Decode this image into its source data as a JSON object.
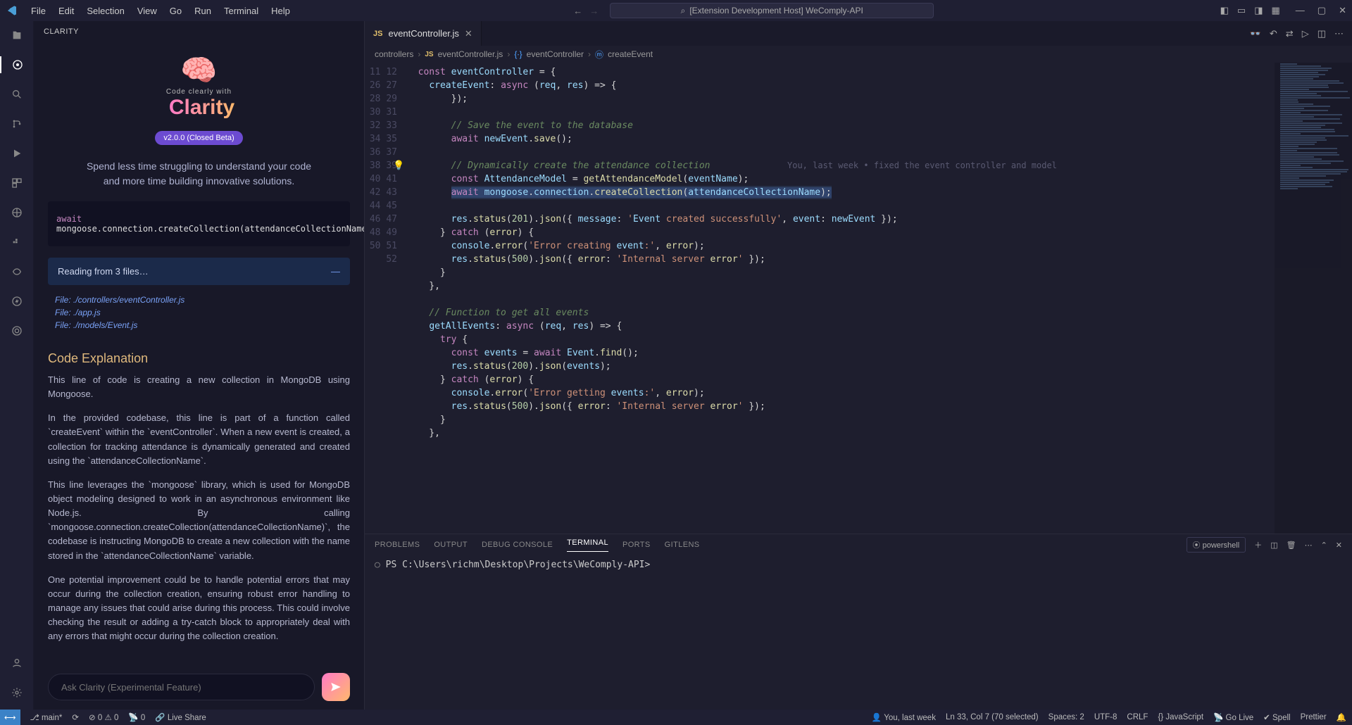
{
  "menu": [
    "File",
    "Edit",
    "Selection",
    "View",
    "Go",
    "Run",
    "Terminal",
    "Help"
  ],
  "search_text": "[Extension Development Host] WeComply-API",
  "sidebar_title": "CLARITY",
  "clarity": {
    "code_clearly": "Code clearly with",
    "name": "Clarity",
    "version": "v2.0.0 (Closed Beta)",
    "tagline1": "Spend less time struggling to understand your code",
    "tagline2": "and more time building innovative solutions.",
    "snippet_kw": "await",
    "snippet_rest": " mongoose.connection.createCollection(attendanceCollectionName);",
    "reading": "Reading from 3 files…",
    "files": [
      "File: ./controllers/eventController.js",
      "File: ./app.js",
      "File: ./models/Event.js"
    ],
    "section": "Code Explanation",
    "p1": "This line of code is creating a new collection in MongoDB using Mongoose.",
    "p2": "In the provided codebase, this line is part of a function called `createEvent` within the `eventController`. When a new event is created, a collection for tracking attendance is dynamically generated and created using the `attendanceCollectionName`.",
    "p3": "This line leverages the `mongoose` library, which is used for MongoDB object modeling designed to work in an asynchronous environment like Node.js. By calling `mongoose.connection.createCollection(attendanceCollectionName)`, the codebase is instructing MongoDB to create a new collection with the name stored in the `attendanceCollectionName` variable.",
    "p4": "One potential improvement could be to handle potential errors that may occur during the collection creation, ensuring robust error handling to manage any issues that could arise during this process. This could involve checking the result or adding a try-catch block to appropriately deal with any errors that might occur during the collection creation.",
    "ask_placeholder": "Ask Clarity (Experimental Feature)"
  },
  "tab": {
    "icon": "JS",
    "name": "eventController.js"
  },
  "breadcrumb": [
    "controllers",
    "eventController.js",
    "eventController",
    "createEvent"
  ],
  "blame": "You, last week • fixed the event controller and model",
  "lines": [
    {
      "n": "11",
      "t": "  const eventController = {",
      "cls": ""
    },
    {
      "n": "12",
      "t": "    createEvent: async (req, res) => {",
      "cls": ""
    },
    {
      "n": "26",
      "t": "        });",
      "cls": ""
    },
    {
      "n": "27",
      "t": "",
      "cls": ""
    },
    {
      "n": "28",
      "t": "        // Save the event to the database",
      "cls": "cm"
    },
    {
      "n": "29",
      "t": "        await newEvent.save();",
      "cls": ""
    },
    {
      "n": "30",
      "t": "",
      "cls": ""
    },
    {
      "n": "31",
      "t": "        // Dynamically create the attendance collection",
      "cls": "cm"
    },
    {
      "n": "32",
      "t": "        const AttendanceModel = getAttendanceModel(eventName);",
      "cls": ""
    },
    {
      "n": "33",
      "t": "        await mongoose.connection.createCollection(attendanceCollectionName);",
      "cls": "hl"
    },
    {
      "n": "34",
      "t": "",
      "cls": ""
    },
    {
      "n": "35",
      "t": "        res.status(201).json({ message: 'Event created successfully', event: newEvent });",
      "cls": ""
    },
    {
      "n": "36",
      "t": "      } catch (error) {",
      "cls": ""
    },
    {
      "n": "37",
      "t": "        console.error('Error creating event:', error);",
      "cls": ""
    },
    {
      "n": "38",
      "t": "        res.status(500).json({ error: 'Internal server error' });",
      "cls": ""
    },
    {
      "n": "39",
      "t": "      }",
      "cls": ""
    },
    {
      "n": "40",
      "t": "    },",
      "cls": ""
    },
    {
      "n": "41",
      "t": "",
      "cls": ""
    },
    {
      "n": "42",
      "t": "    // Function to get all events",
      "cls": "cm"
    },
    {
      "n": "43",
      "t": "    getAllEvents: async (req, res) => {",
      "cls": ""
    },
    {
      "n": "44",
      "t": "      try {",
      "cls": ""
    },
    {
      "n": "45",
      "t": "        const events = await Event.find();",
      "cls": ""
    },
    {
      "n": "46",
      "t": "        res.status(200).json(events);",
      "cls": ""
    },
    {
      "n": "47",
      "t": "      } catch (error) {",
      "cls": ""
    },
    {
      "n": "48",
      "t": "        console.error('Error getting events:', error);",
      "cls": ""
    },
    {
      "n": "49",
      "t": "        res.status(500).json({ error: 'Internal server error' });",
      "cls": ""
    },
    {
      "n": "50",
      "t": "      }",
      "cls": ""
    },
    {
      "n": "51",
      "t": "    },",
      "cls": ""
    },
    {
      "n": "52",
      "t": "",
      "cls": ""
    }
  ],
  "panel_tabs": [
    "PROBLEMS",
    "OUTPUT",
    "DEBUG CONSOLE",
    "TERMINAL",
    "PORTS",
    "GITLENS"
  ],
  "panel_active": "TERMINAL",
  "shell": "powershell",
  "terminal_line": "PS C:\\Users\\richm\\Desktop\\Projects\\WeComply-API>",
  "status": {
    "branch": "main",
    "sync": "",
    "errors": "0",
    "warnings": "0",
    "ports": "0",
    "liveshare": "Live Share",
    "blame_who": "You, last week",
    "position": "Ln 33, Col 7 (70 selected)",
    "spaces": "Spaces: 2",
    "encoding": "UTF-8",
    "eol": "CRLF",
    "lang": "JavaScript",
    "golive": "Go Live",
    "spell": "Spell",
    "prettier": "Prettier"
  }
}
